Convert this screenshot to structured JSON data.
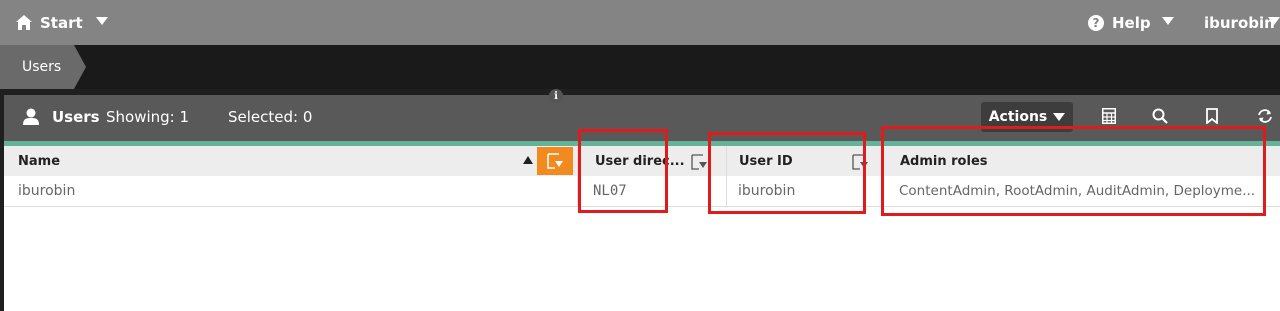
{
  "topbar": {
    "start_label": "Start",
    "help_label": "Help",
    "user_label": "iburobin"
  },
  "breadcrumb": {
    "current": "Users"
  },
  "panel": {
    "title": "Users",
    "showing_label": "Showing: 1",
    "selected_label": "Selected: 0",
    "actions_label": "Actions"
  },
  "table": {
    "columns": [
      {
        "label": "Name"
      },
      {
        "label": "User direc..."
      },
      {
        "label": "User ID"
      },
      {
        "label": "Admin roles"
      }
    ],
    "rows": [
      {
        "name": "iburobin",
        "user_directory": "NL07",
        "user_id": "iburobin",
        "admin_roles": "ContentAdmin, RootAdmin, AuditAdmin, Deployme..."
      }
    ]
  },
  "colors": {
    "topbar": "#848484",
    "accent_teal": "#65b29a",
    "filter_active": "#f38a1f",
    "highlight": "#e01b1b"
  }
}
